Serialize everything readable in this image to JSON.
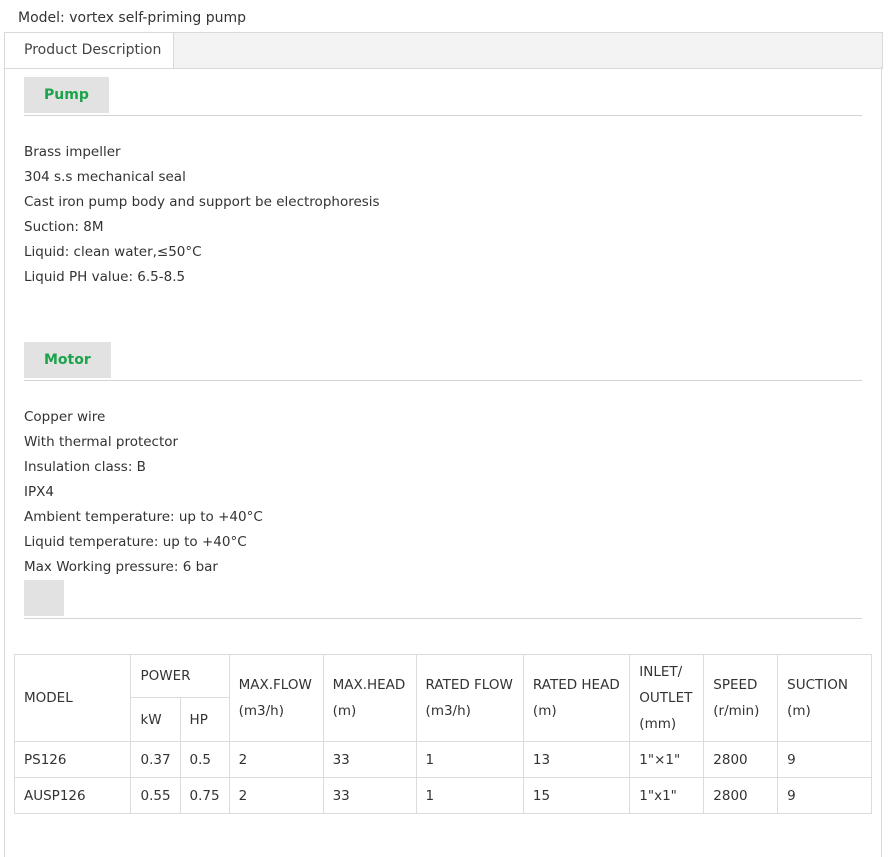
{
  "model": {
    "label": "Model:",
    "value": "vortex self-priming pump"
  },
  "tabs": [
    {
      "label": "Product Description"
    }
  ],
  "sections": {
    "pump": {
      "title": "Pump",
      "lines": [
        "Brass impeller",
        "304 s.s mechanical seal",
        "Cast iron pump body and support be electrophoresis",
        "Suction: 8M",
        "Liquid: clean water,≤50°C",
        "Liquid PH value: 6.5-8.5"
      ]
    },
    "motor": {
      "title": "Motor",
      "lines": [
        "Copper wire",
        "With thermal protector",
        "Insulation class: B",
        "IPX4",
        "Ambient temperature: up to +40°C",
        "Liquid temperature: up to +40°C",
        "Max Working pressure: 6 bar"
      ]
    }
  },
  "table": {
    "headers": {
      "model": "MODEL",
      "power": "POWER",
      "kw": "kW",
      "hp": "HP",
      "max_flow": [
        "MAX.FLOW",
        "(m3/h)"
      ],
      "max_head": [
        "MAX.HEAD",
        "(m)"
      ],
      "rated_flow": [
        "RATED FLOW",
        "(m3/h)"
      ],
      "rated_head": [
        "RATED HEAD",
        "(m)"
      ],
      "inlet_outlet": [
        "INLET/",
        "OUTLET",
        "(mm)"
      ],
      "speed": [
        "SPEED",
        "(r/min)"
      ],
      "suction": [
        "SUCTION",
        "(m)"
      ]
    },
    "rows": [
      [
        "PS126",
        "0.37",
        "0.5",
        "2",
        "33",
        "1",
        "13",
        "1\"×1\"",
        "2800",
        "9"
      ],
      [
        "AUSP126",
        "0.55",
        "0.75",
        "2",
        "33",
        "1",
        "15",
        "1\"x1\"",
        "2800",
        "9"
      ]
    ]
  }
}
